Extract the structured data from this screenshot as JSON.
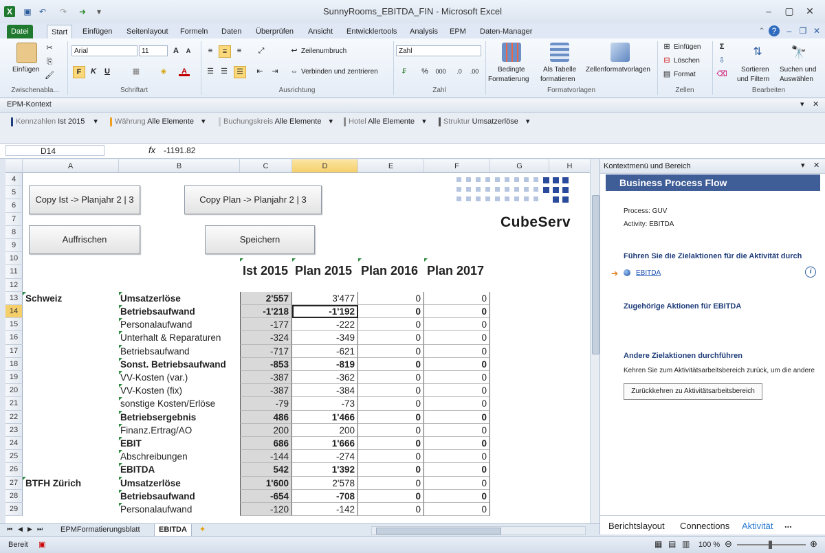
{
  "titlebar": {
    "title": "SunnyRooms_EBITDA_FIN - Microsoft Excel"
  },
  "tabs": [
    "Datei",
    "Start",
    "Einfügen",
    "Seitenlayout",
    "Formeln",
    "Daten",
    "Überprüfen",
    "Ansicht",
    "Entwicklertools",
    "Analysis",
    "EPM",
    "Daten-Manager"
  ],
  "ribbon": {
    "paste": "Einfügen",
    "clipboard": "Zwischenabla...",
    "font_name": "Arial",
    "font_size": "11",
    "bold": "F",
    "italic": "K",
    "underline": "U",
    "font_group": "Schriftart",
    "wrap": "Zeilenumbruch",
    "merge": "Verbinden und zentrieren",
    "align_group": "Ausrichtung",
    "number_format": "Zahl",
    "percent": "%",
    "thousands": "000",
    "number_group": "Zahl",
    "cond_fmt_1": "Bedingte",
    "cond_fmt_2": "Formatierung",
    "as_table_1": "Als Tabelle",
    "as_table_2": "formatieren",
    "cell_styles": "Zellenformatvorlagen",
    "styles_group": "Formatvorlagen",
    "insert": "Einfügen",
    "delete": "Löschen",
    "format": "Format",
    "cells_group": "Zellen",
    "sort_1": "Sortieren",
    "sort_2": "und Filtern",
    "find_1": "Suchen und",
    "find_2": "Auswählen",
    "edit_group": "Bearbeiten"
  },
  "epm": {
    "title": "EPM-Kontext",
    "items": [
      {
        "label": "Kennzahlen",
        "value": "Ist 2015",
        "color": "#1f3d7a"
      },
      {
        "label": "Währung",
        "value": "Alle Elemente",
        "color": "#f0a020"
      },
      {
        "label": "Buchungskreis",
        "value": "Alle Elemente",
        "color": "#c8ccd2"
      },
      {
        "label": "Hotel",
        "value": "Alle Elemente",
        "color": "#8c8c8c"
      },
      {
        "label": "Struktur",
        "value": "Umsatzerlöse",
        "color": "#555555"
      }
    ]
  },
  "formula": {
    "cellref": "D14",
    "fx": "fx",
    "value": "-1191.82"
  },
  "columns": [
    "A",
    "B",
    "C",
    "D",
    "E",
    "F",
    "G",
    "H"
  ],
  "buttons": {
    "copy_ist": "Copy Ist -> Planjahr 2 | 3",
    "copy_plan": "Copy Plan -> Planjahr 2 | 3",
    "refresh": "Auffrischen",
    "save": "Speichern"
  },
  "logo": "CubeServ",
  "headers": [
    "Ist 2015",
    "Plan 2015",
    "Plan 2016",
    "Plan 2017"
  ],
  "rows": [
    {
      "n": "4"
    },
    {
      "n": "5"
    },
    {
      "n": "6"
    },
    {
      "n": "7"
    },
    {
      "n": "8"
    },
    {
      "n": "9"
    },
    {
      "n": "10"
    },
    {
      "n": "11"
    },
    {
      "n": "12"
    },
    {
      "n": "13",
      "a": "Schweiz",
      "b": "Umsatzerlöse",
      "c": "2'557",
      "d": "3'477",
      "e": "0",
      "f": "0",
      "bold": true,
      "bnorm": true
    },
    {
      "n": "14",
      "b": "Betriebsaufwand",
      "c": "-1'218",
      "d": "-1'192",
      "e": "0",
      "f": "0",
      "bold": true,
      "allbold": true
    },
    {
      "n": "15",
      "b": "Personalaufwand",
      "c": "-177",
      "d": "-222",
      "e": "0",
      "f": "0"
    },
    {
      "n": "16",
      "b": "Unterhalt & Reparaturen",
      "c": "-324",
      "d": "-349",
      "e": "0",
      "f": "0"
    },
    {
      "n": "17",
      "b": "Betriebsaufwand",
      "c": "-717",
      "d": "-621",
      "e": "0",
      "f": "0"
    },
    {
      "n": "18",
      "b": "Sonst. Betriebsaufwand",
      "c": "-853",
      "d": "-819",
      "e": "0",
      "f": "0",
      "bold": true,
      "allbold": true
    },
    {
      "n": "19",
      "b": "VV-Kosten (var.)",
      "c": "-387",
      "d": "-362",
      "e": "0",
      "f": "0"
    },
    {
      "n": "20",
      "b": "VV-Kosten (fix)",
      "c": "-387",
      "d": "-384",
      "e": "0",
      "f": "0"
    },
    {
      "n": "21",
      "b": "sonstige Kosten/Erlöse",
      "c": "-79",
      "d": "-73",
      "e": "0",
      "f": "0"
    },
    {
      "n": "22",
      "b": "Betriebsergebnis",
      "c": "486",
      "d": "1'466",
      "e": "0",
      "f": "0",
      "bold": true,
      "allbold": true
    },
    {
      "n": "23",
      "b": "Finanz.Ertrag/AO",
      "c": "200",
      "d": "200",
      "e": "0",
      "f": "0"
    },
    {
      "n": "24",
      "b": "EBIT",
      "c": "686",
      "d": "1'666",
      "e": "0",
      "f": "0",
      "bold": true,
      "allbold": true
    },
    {
      "n": "25",
      "b": "Abschreibungen",
      "c": "-144",
      "d": "-274",
      "e": "0",
      "f": "0"
    },
    {
      "n": "26",
      "b": "EBITDA",
      "c": "542",
      "d": "1'392",
      "e": "0",
      "f": "0",
      "bold": true,
      "allbold": true
    },
    {
      "n": "27",
      "a": "BTFH Zürich",
      "b": "Umsatzerlöse",
      "c": "1'600",
      "d": "2'578",
      "e": "0",
      "f": "0",
      "bold": true,
      "bnorm": true
    },
    {
      "n": "28",
      "b": "Betriebsaufwand",
      "c": "-654",
      "d": "-708",
      "e": "0",
      "f": "0",
      "bold": true,
      "allbold": true
    },
    {
      "n": "29",
      "b": "Personalaufwand",
      "c": "-120",
      "d": "-142",
      "e": "0",
      "f": "0"
    }
  ],
  "pane": {
    "title": "Kontextmenü und Bereich",
    "heading": "Business Process Flow",
    "process": "Process: GUV",
    "activity": "Activity: EBITDA",
    "section1": "Führen Sie die Zielaktionen für die Aktivität durch",
    "link": "EBITDA",
    "section2": "Zugehörige Aktionen für EBITDA",
    "section3": "Andere Zielaktionen durchführen",
    "text3": "Kehren Sie zum Aktivitätsarbeitsbereich zurück, um die andere",
    "backbtn": "Zurückkehren zu Aktivitätsarbeitsbereich",
    "tabs": [
      "Berichtslayout",
      "Connections",
      "Aktivität",
      "..."
    ]
  },
  "sheettabs": [
    "EPMFormatierungsblatt",
    "EBITDA"
  ],
  "status": {
    "ready": "Bereit",
    "zoom": "100 %"
  }
}
